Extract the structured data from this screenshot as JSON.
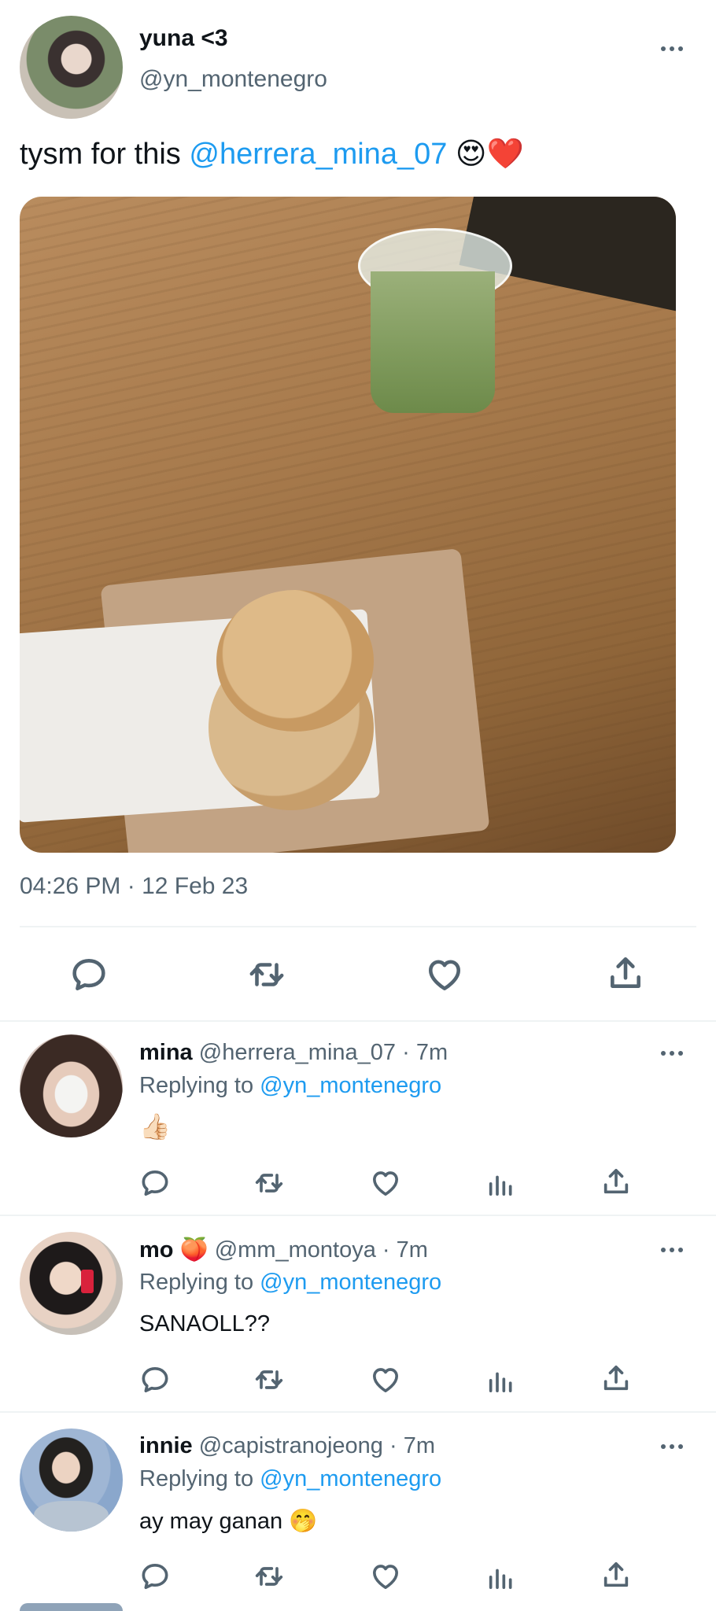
{
  "tweet": {
    "display_name": "yuna <3",
    "handle": "@yn_montenegro",
    "text_prefix": "tysm for this ",
    "mention": "@herrera_mina_07",
    "emoji": "😍❤️",
    "timestamp": "04:26 PM · 12 Feb 23"
  },
  "replies": [
    {
      "display_name": "mina",
      "name_emoji": "",
      "handle": "@herrera_mina_07",
      "time": "· 7m",
      "replying_label": "Replying to",
      "replying_handle": "@yn_montenegro",
      "text": "",
      "text_emoji": "👍🏻"
    },
    {
      "display_name": "mo",
      "name_emoji": "🍑",
      "handle": "@mm_montoya",
      "time": "· 7m",
      "replying_label": "Replying to",
      "replying_handle": "@yn_montenegro",
      "text": "SANAOLL??",
      "text_emoji": ""
    },
    {
      "display_name": "innie",
      "name_emoji": "",
      "handle": "@capistranojeong",
      "time": "· 7m",
      "replying_label": "Replying to",
      "replying_handle": "@yn_montenegro",
      "text": "ay may ganan ",
      "text_emoji": "🤭"
    }
  ],
  "icons": {
    "reply": "comment-bubble-icon",
    "retweet": "retweet-icon",
    "like": "heart-icon",
    "views": "analytics-bars-icon",
    "share": "share-upload-icon",
    "more": "more-dots-icon"
  },
  "colors": {
    "link": "#1d9bf0",
    "muted": "#536471",
    "text": "#0f1419",
    "divider": "#eff3f4"
  }
}
